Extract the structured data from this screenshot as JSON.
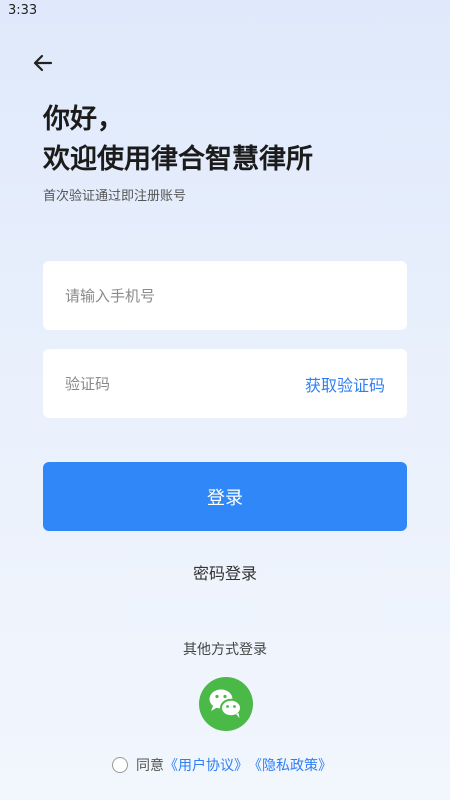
{
  "status_bar": {
    "time": "3:33"
  },
  "header": {
    "title_line1": "你好，",
    "title_line2": "欢迎使用律合智慧律所",
    "subtitle": "首次验证通过即注册账号"
  },
  "form": {
    "phone_placeholder": "请输入手机号",
    "phone_value": "",
    "code_placeholder": "验证码",
    "code_value": "",
    "get_code_label": "获取验证码",
    "login_label": "登录"
  },
  "alt_login": {
    "password_login_label": "密码登录",
    "other_methods_label": "其他方式登录",
    "icon": "wechat-icon",
    "wechat_color": "#4bb948"
  },
  "agreement": {
    "prefix": "同意",
    "user_agreement": "《用户协议》",
    "privacy_policy": "《隐私政策》"
  },
  "colors": {
    "primary": "#2f87f8",
    "link": "#2f7ff3"
  }
}
